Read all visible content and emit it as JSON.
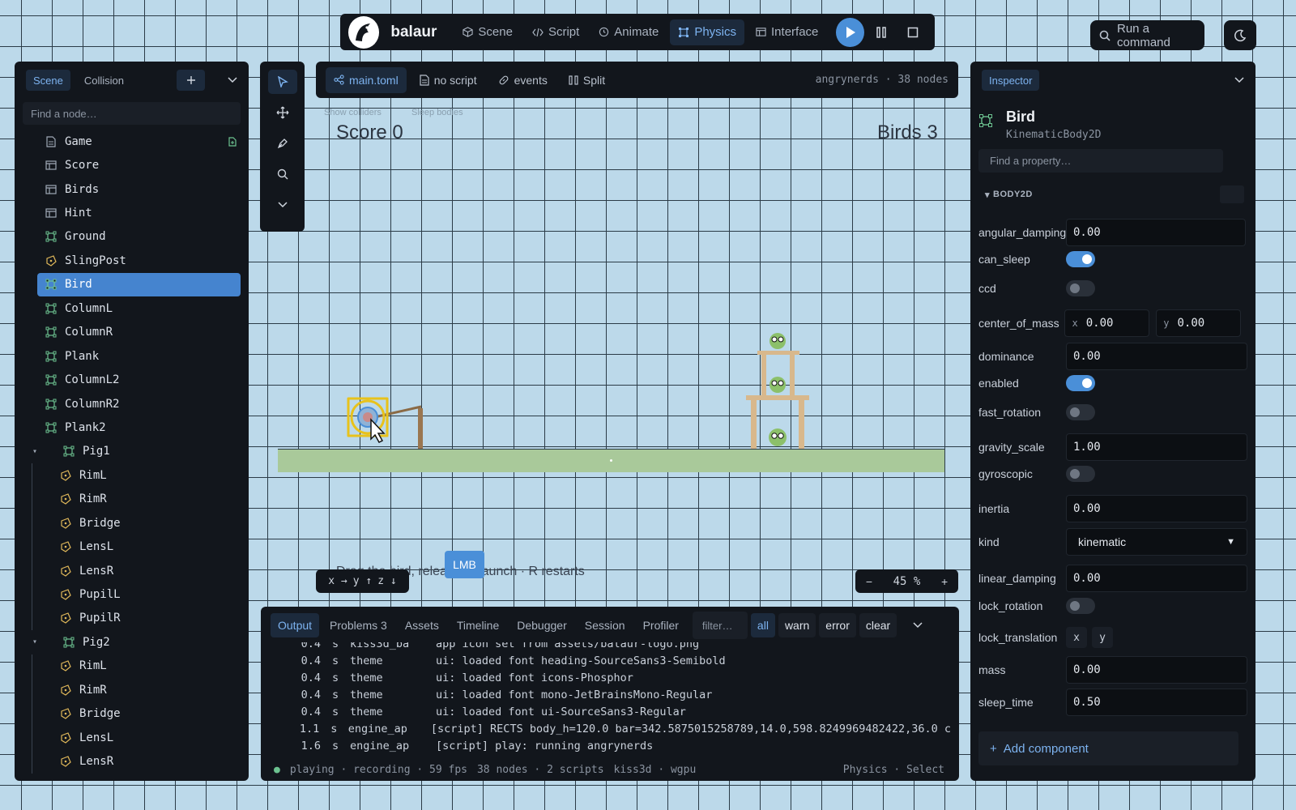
{
  "app": {
    "name": "balaur"
  },
  "top_tabs": [
    {
      "label": "Scene",
      "icon": "cube-icon"
    },
    {
      "label": "Script",
      "icon": "code-icon"
    },
    {
      "label": "Animate",
      "icon": "clock-icon"
    },
    {
      "label": "Physics",
      "icon": "physics-icon",
      "active": true
    },
    {
      "label": "Interface",
      "icon": "layout-icon"
    }
  ],
  "command": {
    "label": "Run a command"
  },
  "scene_panel": {
    "tabs": [
      "Scene",
      "Collision"
    ],
    "search_placeholder": "Find a node…",
    "nodes": [
      {
        "label": "Game",
        "icon": "file-icon",
        "depth": 0,
        "extra": true
      },
      {
        "label": "Score",
        "icon": "table-icon",
        "depth": 0
      },
      {
        "label": "Birds",
        "icon": "table-icon",
        "depth": 0
      },
      {
        "label": "Hint",
        "icon": "table-icon",
        "depth": 0
      },
      {
        "label": "Ground",
        "icon": "body-icon",
        "depth": 0
      },
      {
        "label": "SlingPost",
        "icon": "shape-icon",
        "depth": 0
      },
      {
        "label": "Bird",
        "icon": "body-icon",
        "depth": 0,
        "selected": true
      },
      {
        "label": "ColumnL",
        "icon": "body-icon",
        "depth": 0
      },
      {
        "label": "ColumnR",
        "icon": "body-icon",
        "depth": 0
      },
      {
        "label": "Plank",
        "icon": "body-icon",
        "depth": 0
      },
      {
        "label": "ColumnL2",
        "icon": "body-icon",
        "depth": 0
      },
      {
        "label": "ColumnR2",
        "icon": "body-icon",
        "depth": 0
      },
      {
        "label": "Plank2",
        "icon": "body-icon",
        "depth": 0
      },
      {
        "label": "Pig1",
        "icon": "body-icon",
        "depth": 0,
        "expanded": true
      },
      {
        "label": "RimL",
        "icon": "shape-icon",
        "depth": 1
      },
      {
        "label": "RimR",
        "icon": "shape-icon",
        "depth": 1
      },
      {
        "label": "Bridge",
        "icon": "shape-icon",
        "depth": 1
      },
      {
        "label": "LensL",
        "icon": "shape-icon",
        "depth": 1
      },
      {
        "label": "LensR",
        "icon": "shape-icon",
        "depth": 1
      },
      {
        "label": "PupilL",
        "icon": "shape-icon",
        "depth": 1
      },
      {
        "label": "PupilR",
        "icon": "shape-icon",
        "depth": 1
      },
      {
        "label": "Pig2",
        "icon": "body-icon",
        "depth": 0,
        "expanded": true
      },
      {
        "label": "RimL",
        "icon": "shape-icon",
        "depth": 1
      },
      {
        "label": "RimR",
        "icon": "shape-icon",
        "depth": 1
      },
      {
        "label": "Bridge",
        "icon": "shape-icon",
        "depth": 1
      },
      {
        "label": "LensL",
        "icon": "shape-icon",
        "depth": 1
      },
      {
        "label": "LensR",
        "icon": "shape-icon",
        "depth": 1
      }
    ]
  },
  "viewport": {
    "tabs": [
      {
        "label": "main.toml",
        "icon": "graph-icon",
        "active": true
      },
      {
        "label": "no script",
        "icon": "file-icon"
      },
      {
        "label": "events",
        "icon": "link-icon"
      },
      {
        "label": "Split",
        "icon": "columns-icon"
      }
    ],
    "info": "angrynerds · 38 nodes",
    "ghost_left": "Show colliders",
    "ghost_right": "Sleep bodies",
    "score": "Score 0",
    "birds": "Birds 3",
    "hint": "Drag the bird, release to launch · R restarts",
    "lmb": "LMB",
    "axes": [
      "x →",
      "y ↑",
      "z ↓"
    ],
    "zoom": "45 %"
  },
  "console": {
    "tabs": [
      "Output",
      "Problems 3",
      "Assets",
      "Timeline",
      "Debugger",
      "Session",
      "Profiler"
    ],
    "filter_placeholder": "filter…",
    "levels": [
      "all",
      "warn",
      "error",
      "clear"
    ],
    "logs": [
      {
        "t": "0.4",
        "u": "s",
        "mod": "kiss3d_ba",
        "msg": "app icon set from assets/balaur-logo.png"
      },
      {
        "t": "0.4",
        "u": "s",
        "mod": "theme",
        "msg": "ui: loaded font heading-SourceSans3-Semibold"
      },
      {
        "t": "0.4",
        "u": "s",
        "mod": "theme",
        "msg": "ui: loaded font icons-Phosphor"
      },
      {
        "t": "0.4",
        "u": "s",
        "mod": "theme",
        "msg": "ui: loaded font mono-JetBrainsMono-Regular"
      },
      {
        "t": "0.4",
        "u": "s",
        "mod": "theme",
        "msg": "ui: loaded font ui-SourceSans3-Regular"
      },
      {
        "t": "1.1",
        "u": "s",
        "mod": "engine_ap",
        "msg": "[script] RECTS body_h=120.0 bar=342.5875015258789,14.0,598.8249969482422,36.0 c"
      },
      {
        "t": "1.6",
        "u": "s",
        "mod": "engine_ap",
        "msg": "[script] play: running angrynerds"
      }
    ],
    "status_left": "playing · recording · 59 fps",
    "status_mid": "38 nodes · 2 scripts",
    "status_mid2": "kiss3d · wgpu",
    "status_right": "Physics · Select"
  },
  "inspector": {
    "tab": "Inspector",
    "node_name": "Bird",
    "node_type": "KinematicBody2D",
    "search_placeholder": "Find a property…",
    "section": "BODY2D",
    "props": [
      {
        "label": "angular_damping",
        "kind": "field",
        "value": "0.00"
      },
      {
        "label": "can_sleep",
        "kind": "toggle",
        "on": true
      },
      {
        "label": "ccd",
        "kind": "toggle",
        "on": false
      },
      {
        "label": "center_of_mass",
        "kind": "vec2",
        "x": "0.00",
        "y": "0.00"
      },
      {
        "label": "dominance",
        "kind": "field",
        "value": "0.00"
      },
      {
        "label": "enabled",
        "kind": "toggle",
        "on": true
      },
      {
        "label": "fast_rotation",
        "kind": "toggle",
        "on": false
      },
      {
        "label": "gravity_scale",
        "kind": "field",
        "value": "1.00"
      },
      {
        "label": "gyroscopic",
        "kind": "toggle",
        "on": false
      },
      {
        "label": "inertia",
        "kind": "field",
        "value": "0.00"
      },
      {
        "label": "kind",
        "kind": "select",
        "value": "kinematic"
      },
      {
        "label": "linear_damping",
        "kind": "field",
        "value": "0.00"
      },
      {
        "label": "lock_rotation",
        "kind": "toggle",
        "on": false
      },
      {
        "label": "lock_translation",
        "kind": "axes",
        "x": "x",
        "y": "y"
      },
      {
        "label": "mass",
        "kind": "field",
        "value": "0.00"
      },
      {
        "label": "sleep_time",
        "kind": "field",
        "value": "0.50"
      }
    ],
    "add_component": "Add component"
  },
  "colors": {
    "accent": "#4a8fd8",
    "panel": "#12161c",
    "selected": "#4584cf",
    "canvas": "#bcd9ea"
  }
}
